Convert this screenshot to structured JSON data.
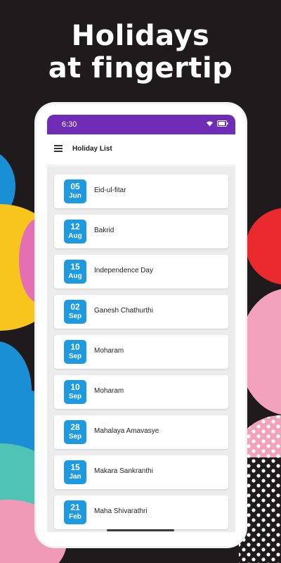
{
  "headline": {
    "line1": "Holidays",
    "line2": "at fingertip"
  },
  "status_bar": {
    "time": "6:30",
    "icons": [
      "wifi-icon",
      "battery-icon"
    ]
  },
  "app_bar": {
    "title": "Holiday List",
    "menu_icon": "hamburger-menu-icon"
  },
  "colors": {
    "accent": "#6f2db7",
    "badge": "#1e9be0",
    "background": "#1f1a1b"
  },
  "holidays": [
    {
      "day": "05",
      "month": "Jun",
      "name": "Eid-ul-fitar"
    },
    {
      "day": "12",
      "month": "Aug",
      "name": "Bakrid"
    },
    {
      "day": "15",
      "month": "Aug",
      "name": "Independence Day"
    },
    {
      "day": "02",
      "month": "Sep",
      "name": "Ganesh Chathurthi"
    },
    {
      "day": "10",
      "month": "Sep",
      "name": "Moharam"
    },
    {
      "day": "10",
      "month": "Sep",
      "name": "Moharam"
    },
    {
      "day": "28",
      "month": "Sep",
      "name": "Mahalaya Amavasye"
    },
    {
      "day": "15",
      "month": "Jan",
      "name": "Makara Sankranthi"
    },
    {
      "day": "21",
      "month": "Feb",
      "name": "Maha Shivarathri"
    }
  ]
}
